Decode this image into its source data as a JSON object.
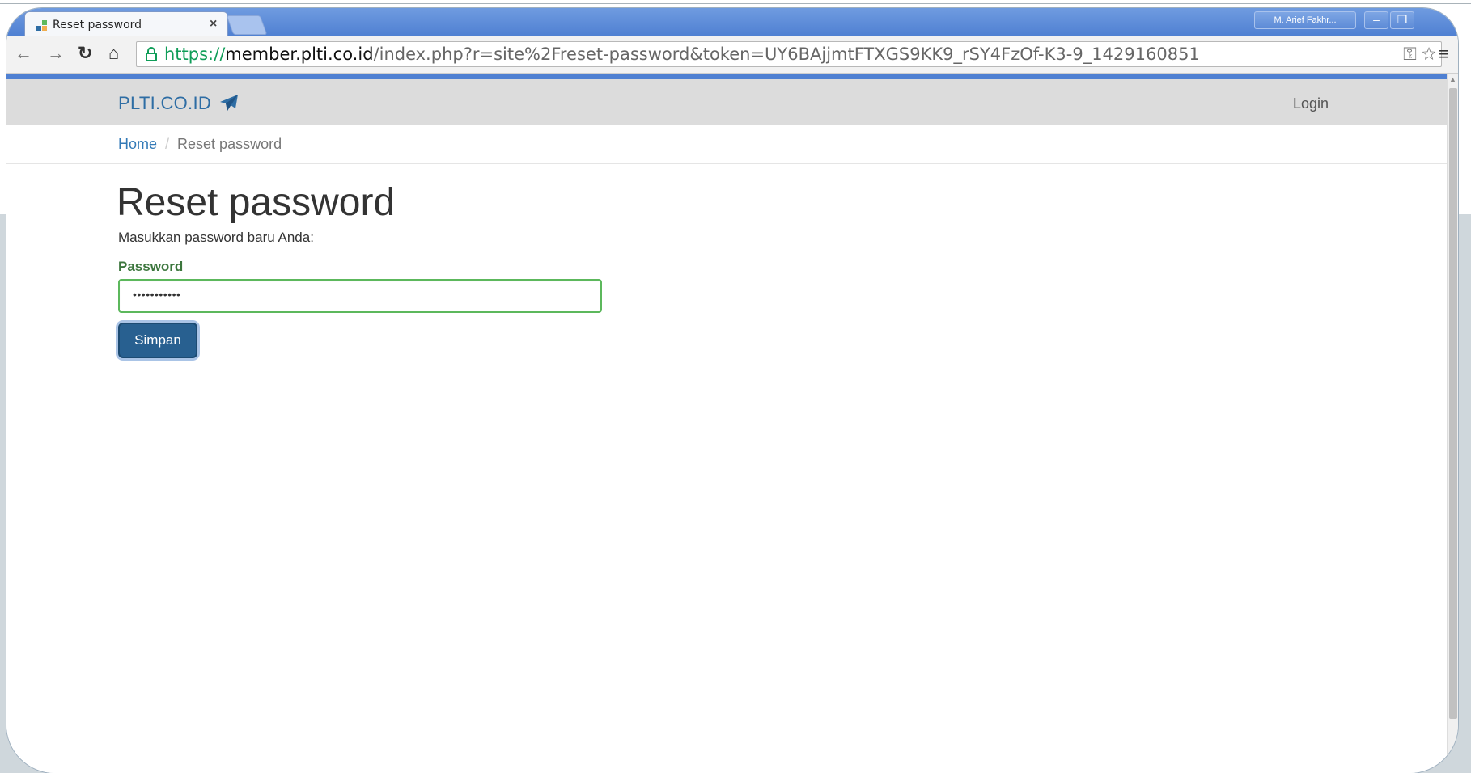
{
  "browser": {
    "tab_title": "Reset password",
    "tab_close": "×",
    "profile_name": "M. Arief Fakhr...",
    "url": {
      "scheme": "https://",
      "host": "member.plti.co.id",
      "path": "/index.php?r=site%2Freset-password&token=UY6BAjjmtFTXGS9KK9_rSY4FzOf-K3-9_1429160851"
    }
  },
  "navbar": {
    "brand": "PLTI.CO.ID",
    "login": "Login"
  },
  "breadcrumb": {
    "home": "Home",
    "separator": "/",
    "current": "Reset password"
  },
  "form": {
    "title": "Reset password",
    "instruction": "Masukkan password baru Anda:",
    "password_label": "Password",
    "password_value": "•••••••••••",
    "submit_label": "Simpan"
  },
  "colors": {
    "link": "#337ab7",
    "brand": "#2e6da4",
    "success": "#3c763d",
    "input_border": "#5cb85c",
    "primary_button": "#286090",
    "chrome_frame": "#4f80d2"
  },
  "icons": {
    "tab_favicon": "favicon-icon",
    "back": "back-arrow-icon",
    "forward": "forward-arrow-icon",
    "reload": "reload-icon",
    "home": "home-icon",
    "secure": "lock-icon",
    "key": "key-icon",
    "bookmark": "star-icon",
    "menu": "hamburger-menu-icon",
    "brand": "paper-plane-icon"
  }
}
